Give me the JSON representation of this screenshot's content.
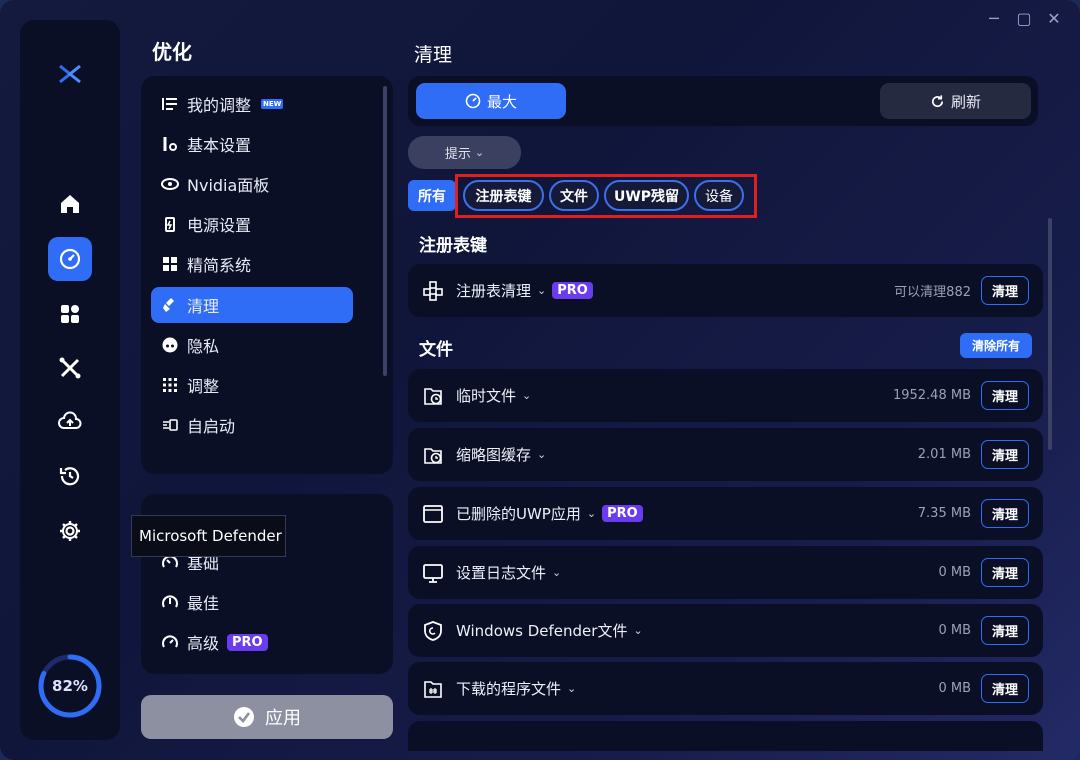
{
  "window": {
    "controls": [
      "minimize",
      "maximize",
      "close"
    ]
  },
  "rail": {
    "items": [
      "home",
      "optimize",
      "apps",
      "tools",
      "cloud",
      "restore",
      "settings"
    ],
    "active": "optimize",
    "gauge_percent": 82,
    "gauge_label": "82%"
  },
  "optimize": {
    "title": "优化",
    "menu": [
      {
        "label": "我的调整",
        "icon": "list-icon",
        "badge": "NEW"
      },
      {
        "label": "基本设置",
        "icon": "wrench-gear-icon"
      },
      {
        "label": "Nvidia面板",
        "icon": "nvidia-icon"
      },
      {
        "label": "电源设置",
        "icon": "battery-icon"
      },
      {
        "label": "精简系统",
        "icon": "windows-icon"
      },
      {
        "label": "清理",
        "icon": "broom-icon",
        "active": true
      },
      {
        "label": "隐私",
        "icon": "privacy-icon"
      },
      {
        "label": "调整",
        "icon": "grid-icon"
      },
      {
        "label": "自启动",
        "icon": "startup-icon"
      }
    ],
    "modes": [
      {
        "label": "基础",
        "icon": "gauge-low-icon"
      },
      {
        "label": "最佳",
        "icon": "gauge-mid-icon"
      },
      {
        "label": "高级",
        "icon": "gauge-high-icon",
        "badge": "PRO"
      }
    ],
    "tooltip": "Microsoft Defender",
    "apply_label": "应用"
  },
  "clean": {
    "title": "清理",
    "max_label": "最大",
    "refresh_label": "刷新",
    "hint_label": "提示",
    "filters": {
      "all": "所有",
      "chips": [
        "注册表键",
        "文件",
        "UWP残留",
        "设备"
      ]
    },
    "registry_group": {
      "title": "注册表键",
      "rows": [
        {
          "label": "注册表清理",
          "badge": "PRO",
          "size": "可以清理882",
          "action": "清理",
          "icon": "registry-icon"
        }
      ]
    },
    "files_group": {
      "title": "文件",
      "clear_all_label": "清除所有",
      "rows": [
        {
          "label": "临时文件",
          "size": "1952.48 MB",
          "action": "清理",
          "icon": "temp-file-icon"
        },
        {
          "label": "缩略图缓存",
          "size": "2.01 MB",
          "action": "清理",
          "icon": "thumbnail-cache-icon"
        },
        {
          "label": "已删除的UWP应用",
          "badge": "PRO",
          "size": "7.35 MB",
          "action": "清理",
          "icon": "window-icon"
        },
        {
          "label": "设置日志文件",
          "size": "0 MB",
          "action": "清理",
          "icon": "monitor-icon"
        },
        {
          "label": "Windows Defender文件",
          "size": "0 MB",
          "action": "清理",
          "icon": "shield-icon"
        },
        {
          "label": "下载的程序文件",
          "size": "0 MB",
          "action": "清理",
          "icon": "download-folder-icon"
        }
      ]
    }
  },
  "colors": {
    "accent": "#2f6df6",
    "pro": "#6a3cf0",
    "panel": "#0b0f26",
    "highlight": "#e0201f"
  }
}
